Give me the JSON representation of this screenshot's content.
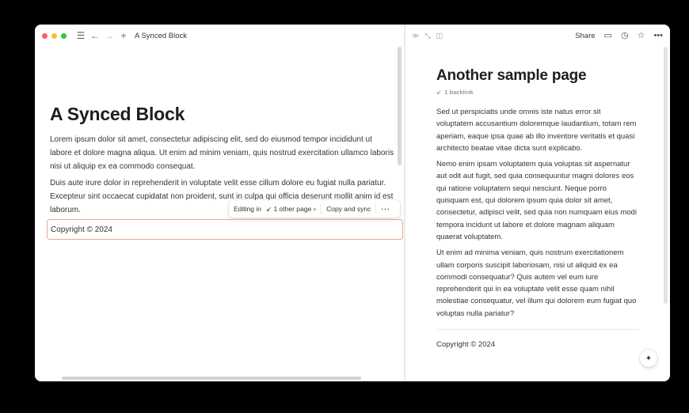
{
  "left": {
    "window_title": "A Synced Block",
    "icons": {
      "menu": "☰",
      "back": "←",
      "forward": "→",
      "new": "+"
    },
    "doc_title": "A Synced Block",
    "paragraph1": "Lorem ipsum dolor sit amet, consectetur adipiscing elit, sed do eiusmod tempor incididunt ut labore et dolore magna aliqua. Ut enim ad minim veniam, quis nostrud exercitation ullamco laboris nisi ut aliquip ex ea commodo consequat.",
    "paragraph2": "Duis aute irure dolor in reprehenderit in voluptate velit esse cillum dolore eu fugiat nulla pariatur. Excepteur sint occaecat cupidatat non proident, sunt in culpa qui officia deserunt mollit anim id est laborum.",
    "sync_toolbar": {
      "editing_in": "Editing in",
      "other_pages": "1 other page",
      "copy_and_sync": "Copy and sync",
      "more": "···"
    },
    "synced_block_text": "Copyright © 2024",
    "synced_border_color": "#f2a191"
  },
  "right": {
    "share_label": "Share",
    "doc_title": "Another sample page",
    "backlink": "1 backlink",
    "paragraph1": "Sed ut perspiciatis unde omnis iste natus error sit voluptatem accusantium doloremque laudantium, totam rem aperiam, eaque ipsa quae ab illo inventore veritatis et quasi architecto beatae vitae dicta sunt explicabo.",
    "paragraph2": "Nemo enim ipsam voluptatem quia voluptas sit aspernatur aut odit aut fugit, sed quia consequuntur magni dolores eos qui ratione voluptatem sequi nesciunt. Neque porro quisquam est, qui dolorem ipsum quia dolor sit amet, consectetur, adipisci velit, sed quia non numquam eius modi tempora incidunt ut labore et dolore magnam aliquam quaerat voluptatem.",
    "paragraph3": "Ut enim ad minima veniam, quis nostrum exercitationem ullam corporis suscipit laboriosam, nisi ut aliquid ex ea commodi consequatur? Quis autem vel eum iure reprehenderit qui in ea voluptate velit esse quam nihil molestiae consequatur, vel illum qui dolorem eum fugiat quo voluptas nulla pariatur?",
    "copyright": "Copyright © 2024"
  }
}
